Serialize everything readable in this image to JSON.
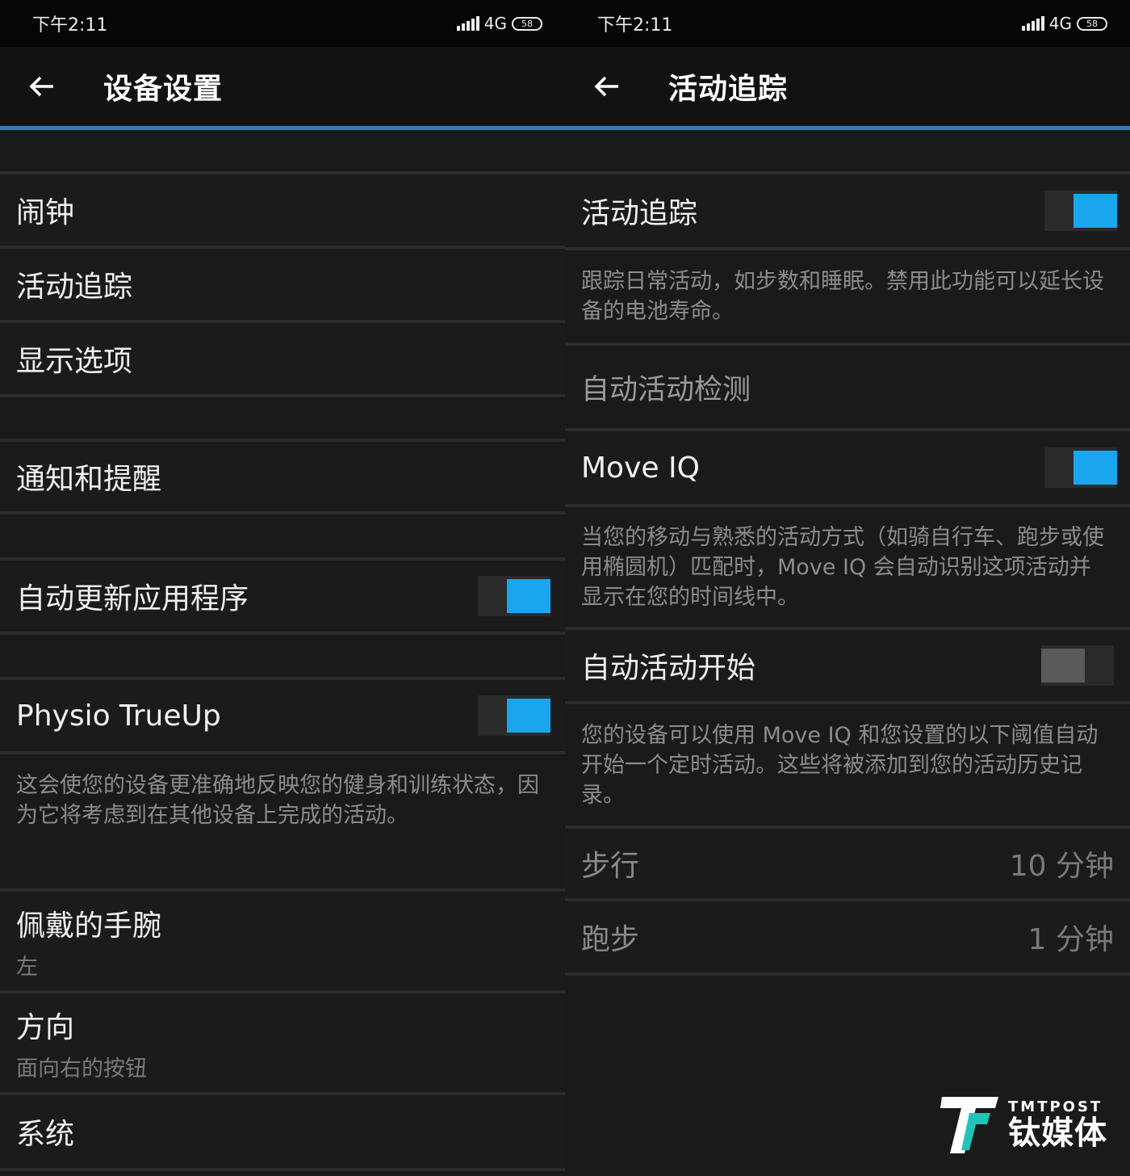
{
  "status": {
    "time": "下午2:11",
    "network": "4G",
    "battery": "58"
  },
  "left": {
    "title": "设备设置",
    "items": {
      "alarm": "闹钟",
      "activity_tracking": "活动追踪",
      "display_options": "显示选项",
      "notifications": "通知和提醒",
      "auto_update": "自动更新应用程序",
      "physio": "Physio TrueUp",
      "physio_desc": "这会使您的设备更准确地反映您的健身和训练状态，因为它将考虑到在其他设备上完成的活动。",
      "wrist": "佩戴的手腕",
      "wrist_value": "左",
      "orientation": "方向",
      "orientation_value": "面向右的按钮",
      "system": "系统"
    },
    "toggles": {
      "auto_update": true,
      "physio": true
    }
  },
  "right": {
    "title": "活动追踪",
    "activity_tracking": "活动追踪",
    "activity_tracking_desc": "跟踪日常活动，如步数和睡眠。禁用此功能可以延长设备的电池寿命。",
    "auto_detect_header": "自动活动检测",
    "move_iq": "Move IQ",
    "move_iq_desc": "当您的移动与熟悉的活动方式（如骑自行车、跑步或使用椭圆机）匹配时，Move IQ 会自动识别这项活动并显示在您的时间线中。",
    "auto_start": "自动活动开始",
    "auto_start_desc": "您的设备可以使用 Move IQ 和您设置的以下阈值自动开始一个定时活动。这些将被添加到您的活动历史记录。",
    "walk_label": "步行",
    "walk_value": "10 分钟",
    "run_label": "跑步",
    "run_value": "1 分钟",
    "toggles": {
      "activity_tracking": true,
      "move_iq": true,
      "auto_start": false
    }
  },
  "watermark": {
    "en": "TMTPOST",
    "cn": "钛媒体"
  },
  "colors": {
    "accent": "#1aa6ef",
    "appbar_line": "#2f7fb5",
    "background": "#1a1a1a"
  }
}
